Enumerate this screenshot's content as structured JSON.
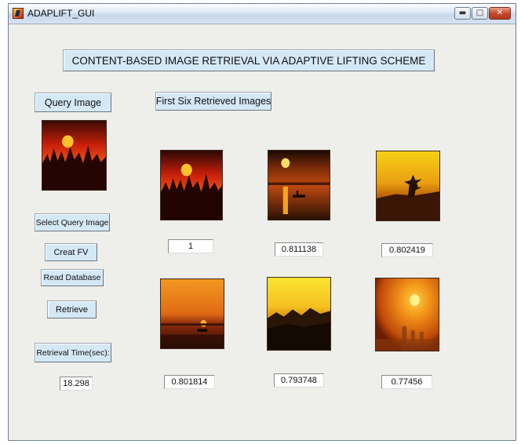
{
  "window": {
    "title": "ADAPLIFT_GUI",
    "controls": {
      "minimize_icon": "minimize-icon",
      "maximize_icon": "maximize-icon",
      "close_icon": "close-icon"
    }
  },
  "header": {
    "title": "CONTENT-BASED IMAGE RETRIEVAL VIA ADAPTIVE LIFTING SCHEME"
  },
  "left_panel": {
    "query_image_label": "Query Image",
    "select_query_button": "Select Query Image",
    "create_fv_button": "Creat FV",
    "read_database_button": "Read Database",
    "retrieve_button": "Retrieve",
    "retrieval_time_label": "Retrieval Time(sec):",
    "retrieval_time_value": "18.298"
  },
  "results": {
    "heading": "First Six Retrieved Images",
    "items": [
      {
        "scene": "sunset-over-trees",
        "score": "1"
      },
      {
        "scene": "sun-over-water-with-boat",
        "score": "0.811138"
      },
      {
        "scene": "golden-sky-tree-silhouette",
        "score": "0.802419"
      },
      {
        "scene": "sunset-over-sea-with-boat",
        "score": "0.801814"
      },
      {
        "scene": "yellow-sky-over-mountains",
        "score": "0.793748"
      },
      {
        "scene": "sun-haze-over-towers",
        "score": "0.77456"
      }
    ]
  },
  "colors": {
    "button_face": "#d5e8f6",
    "window_background": "#eeeeea",
    "field_background": "#ffffff"
  }
}
